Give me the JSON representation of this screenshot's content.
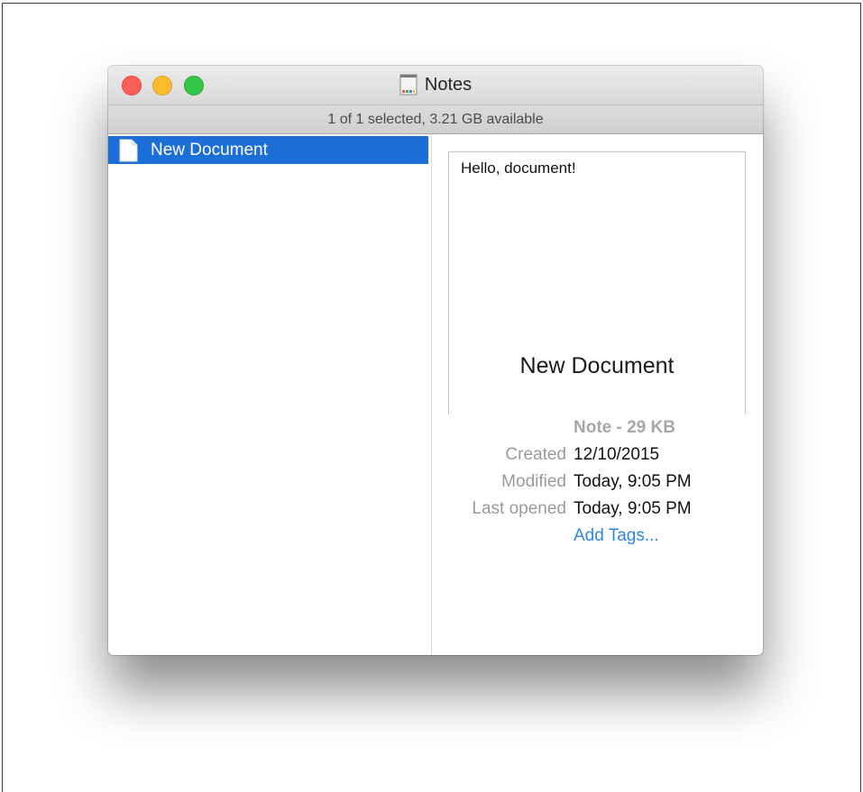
{
  "window": {
    "title": "Notes",
    "title_icon": "notes-document-icon"
  },
  "status_bar": {
    "text": "1 of 1 selected, 3.21 GB available"
  },
  "sidebar": {
    "items": [
      {
        "label": "New Document",
        "icon": "document-icon",
        "selected": true
      }
    ]
  },
  "preview": {
    "content_text": "Hello, document!",
    "document_title": "New Document"
  },
  "info": {
    "kind": "Note - 29 KB",
    "rows": [
      {
        "label": "Created",
        "value": "12/10/2015"
      },
      {
        "label": "Modified",
        "value": "Today, 9:05 PM"
      },
      {
        "label": "Last opened",
        "value": "Today, 9:05 PM"
      }
    ],
    "add_tags": "Add Tags..."
  },
  "colors": {
    "selection": "#1d6fd8",
    "link": "#2f86e6",
    "close": "#fc5f57",
    "minimize": "#fdbc2e",
    "maximize": "#33c748"
  }
}
